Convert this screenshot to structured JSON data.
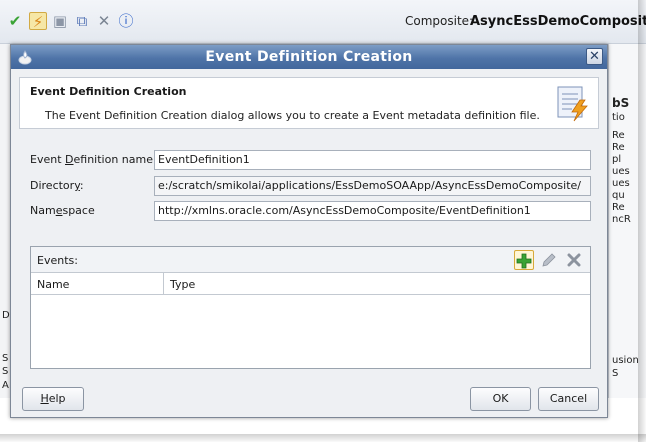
{
  "ide": {
    "composite_label": "Composite:",
    "composite_name": "AsyncEssDemoComposite",
    "right_fragments": [
      "bS",
      "tio",
      "Re",
      "Re",
      "pl",
      "ues",
      "ues",
      "qu",
      "Re",
      "ncR",
      "usion",
      "S"
    ],
    "left_fragments": [
      "D",
      "S",
      "S",
      "A"
    ]
  },
  "dialog": {
    "title": "Event Definition Creation",
    "header": {
      "title": "Event Definition Creation",
      "description": "The Event Definition Creation dialog allows you to create a Event metadata definition file."
    },
    "fields": {
      "name_label_pre": "Event ",
      "name_label_mnemonic": "D",
      "name_label_post": "efinition name:",
      "name_value": "EventDefinition1",
      "directory_label_pre": "Director",
      "directory_label_mnemonic": "y",
      "directory_label_post": ":",
      "directory_value": "e:/scratch/smikolai/applications/EssDemoSOAApp/AsyncEssDemoComposite/",
      "namespace_label_pre": "Nam",
      "namespace_label_mnemonic": "e",
      "namespace_label_post": "space",
      "namespace_value": "http://xmlns.oracle.com/AsyncEssDemoComposite/EventDefinition1"
    },
    "events": {
      "label": "Events:",
      "columns": [
        "Name",
        "Type"
      ]
    },
    "buttons": {
      "help_mnemonic": "H",
      "help_rest": "elp",
      "ok": "OK",
      "cancel": "Cancel"
    }
  },
  "colors": {
    "titlebar": "#4f74a8",
    "add_highlight": "#d7a93a",
    "check_green": "#3aa335",
    "delete_gray": "#7b8593"
  }
}
